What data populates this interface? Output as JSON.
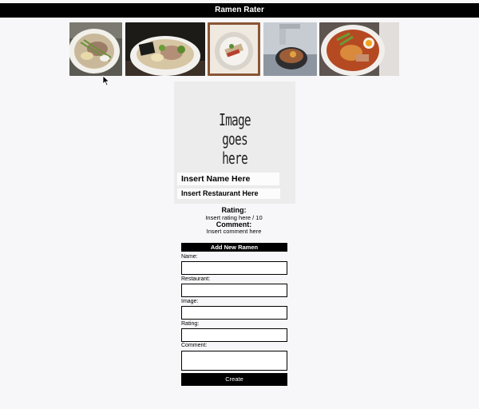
{
  "app": {
    "title": "Ramen Rater"
  },
  "menu": {
    "images": [
      {
        "name": "ramen-thumbnail-1"
      },
      {
        "name": "ramen-thumbnail-2"
      },
      {
        "name": "ramen-thumbnail-3"
      },
      {
        "name": "ramen-thumbnail-4"
      },
      {
        "name": "ramen-thumbnail-5"
      }
    ]
  },
  "detail": {
    "image_placeholder": "Image\ngoes\nhere",
    "name": "Insert Name Here",
    "restaurant": "Insert Restaurant Here",
    "rating_heading": "Rating:",
    "rating_value": "Insert rating here / 10",
    "comment_heading": "Comment:",
    "comment_value": "Insert comment here"
  },
  "form": {
    "title": "Add New Ramen",
    "name_label": "Name:",
    "restaurant_label": "Restaurant:",
    "image_label": "Image:",
    "rating_label": "Rating:",
    "comment_label": "Comment:",
    "submit_label": "Create"
  },
  "colors": {
    "header_bg": "#000000",
    "page_bg": "#f7f7f9",
    "button_bg": "#000000"
  }
}
